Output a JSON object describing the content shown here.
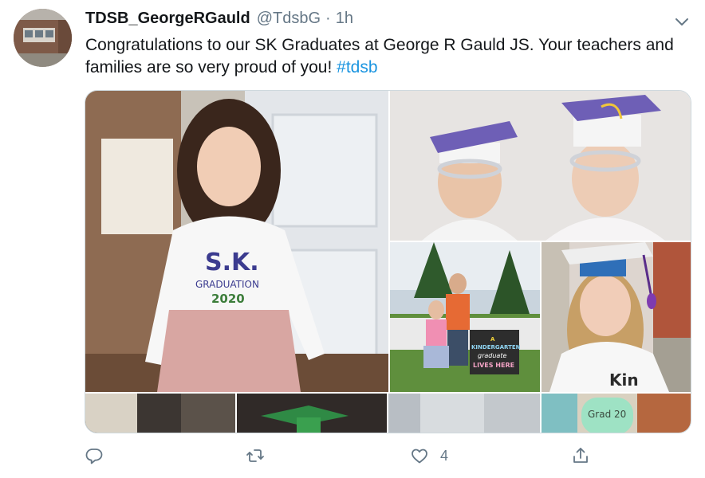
{
  "tweet": {
    "display_name": "TDSB_GeorgeRGauld",
    "handle": "@TdsbG",
    "separator": "·",
    "time": "1h",
    "text_main": "Congratulations to our SK Graduates at George R Gauld JS. Your teachers and families are so very proud of you! ",
    "hashtag": "#tdsb"
  },
  "media": {
    "photo1": {
      "shirt_line1": "S.K.",
      "shirt_line2": "GRADUATION",
      "shirt_line3": "2020"
    },
    "photo3": {
      "sign_line1": "A",
      "sign_line2": "KINDERGARTEN",
      "sign_line3": "graduate",
      "sign_line4": "LIVES HERE"
    },
    "photo4": {
      "shirt_text": "Kin"
    },
    "photo7": {
      "hat_text": "Grad 20"
    }
  },
  "actions": {
    "reply_count": "",
    "retweet_count": "",
    "like_count": "4",
    "share_count": ""
  },
  "colors": {
    "link": "#1b95e0",
    "secondary_text": "#657786",
    "border": "#cfd9de"
  },
  "icons": [
    "caret-down-icon",
    "reply-icon",
    "retweet-icon",
    "like-icon",
    "share-icon"
  ]
}
